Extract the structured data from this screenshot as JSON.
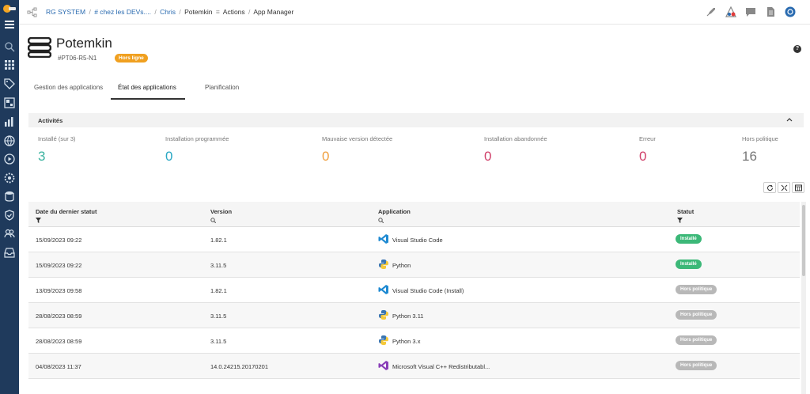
{
  "breadcrumb": {
    "items": [
      {
        "label": "RG SYSTEM",
        "link": true
      },
      {
        "label": "# chez les DEVs....",
        "link": true
      },
      {
        "label": "Chris",
        "link": true
      },
      {
        "label": "Potemkin",
        "link": false
      },
      {
        "label": "Actions",
        "link": false
      },
      {
        "label": "App Manager",
        "link": false
      }
    ]
  },
  "device": {
    "name": "Potemkin",
    "id": "#PT06-R5-N1",
    "status_badge": "Hors ligne",
    "badge_color": "#f0a020"
  },
  "help_icon": "?",
  "tabs": [
    {
      "label": "Gestion des applications",
      "active": false
    },
    {
      "label": "État des applications",
      "active": true
    },
    {
      "label": "Planification",
      "active": false
    }
  ],
  "activities": {
    "title": "Activités",
    "stats": [
      {
        "label": "Installé (sur 3)",
        "value": "3",
        "color": "#3cb3a0"
      },
      {
        "label": "Installation programmée",
        "value": "0",
        "color": "#2aa8c4"
      },
      {
        "label": "Mauvaise version détectée",
        "value": "0",
        "color": "#f0a040"
      },
      {
        "label": "Installation abandonnée",
        "value": "0",
        "color": "#d0406a"
      },
      {
        "label": "Erreur",
        "value": "0",
        "color": "#d0406a"
      },
      {
        "label": "Hors politique",
        "value": "16",
        "color": "#777777"
      }
    ]
  },
  "table": {
    "columns": [
      "Date du dernier statut",
      "Version",
      "Application",
      "Statut"
    ],
    "rows": [
      {
        "date": "15/09/2023 09:22",
        "version": "1.82.1",
        "app": "Visual Studio Code",
        "icon": "vscode-icon",
        "status": "Installé",
        "status_color": "#3cb878"
      },
      {
        "date": "15/09/2023 09:22",
        "version": "3.11.5",
        "app": "Python",
        "icon": "python-icon",
        "status": "Installé",
        "status_color": "#3cb878"
      },
      {
        "date": "13/09/2023 09:58",
        "version": "1.82.1",
        "app": "Visual Studio Code (Install)",
        "icon": "vscode-icon",
        "status": "Hors politique",
        "status_color": "#b8b8b8"
      },
      {
        "date": "28/08/2023 08:59",
        "version": "3.11.5",
        "app": "Python 3.11",
        "icon": "python-icon",
        "status": "Hors politique",
        "status_color": "#b8b8b8"
      },
      {
        "date": "28/08/2023 08:59",
        "version": "3.11.5",
        "app": "Python 3.x",
        "icon": "python-icon",
        "status": "Hors politique",
        "status_color": "#b8b8b8"
      },
      {
        "date": "04/08/2023 11:37",
        "version": "14.0.24215.20170201",
        "app": "Microsoft Visual C++ Redistributabl...",
        "icon": "visual-studio-icon",
        "status": "Hors politique",
        "status_color": "#b8b8b8"
      }
    ]
  },
  "colors": {
    "sidebar": "#1f3a5c",
    "link": "#2a6bb0"
  }
}
